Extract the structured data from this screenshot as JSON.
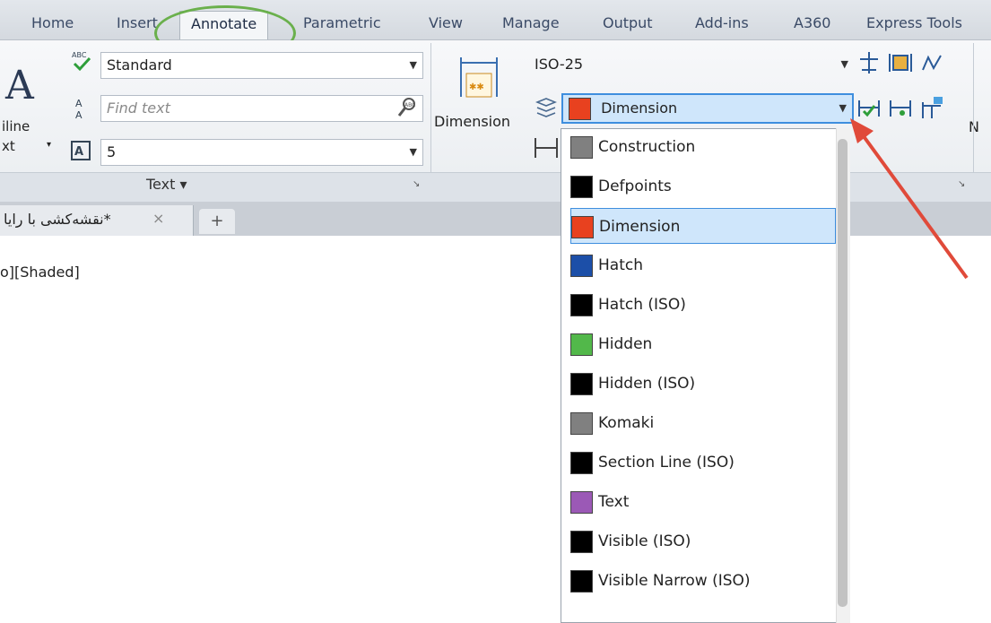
{
  "ribbon_tabs": [
    "Home",
    "Insert",
    "Annotate",
    "Parametric",
    "View",
    "Manage",
    "Output",
    "Add-ins",
    "A360",
    "Express Tools"
  ],
  "active_tab": "Annotate",
  "text_panel": {
    "big_label_line1": "iline",
    "big_label_line2": "xt",
    "style_value": "Standard",
    "find_placeholder": "Find text",
    "height_value": "5",
    "panel_title": "Text ▾"
  },
  "dim_panel": {
    "button_label": "Dimension",
    "dimstyle_value": "ISO-25",
    "layer_value": "Dimension",
    "layer_color": "#e8411f"
  },
  "right_edge_label": "N",
  "doc_tab": {
    "title": "*نقشه‌کشی با رایا",
    "close": "×",
    "new_tab": "+"
  },
  "viewport_label": "o][Shaded]",
  "layer_dropdown": {
    "items": [
      {
        "name": "Construction",
        "color": "#808080"
      },
      {
        "name": "Defpoints",
        "color": "#000000"
      },
      {
        "name": "Dimension",
        "color": "#e8411f",
        "selected": true
      },
      {
        "name": "Hatch",
        "color": "#1c4fa8"
      },
      {
        "name": "Hatch (ISO)",
        "color": "#000000"
      },
      {
        "name": "Hidden",
        "color": "#52b84a"
      },
      {
        "name": "Hidden (ISO)",
        "color": "#000000"
      },
      {
        "name": "Komaki",
        "color": "#808080"
      },
      {
        "name": "Section Line (ISO)",
        "color": "#000000"
      },
      {
        "name": "Text",
        "color": "#9b59b6"
      },
      {
        "name": "Visible (ISO)",
        "color": "#000000"
      },
      {
        "name": "Visible Narrow (ISO)",
        "color": "#000000"
      }
    ]
  },
  "icons": {
    "spellcheck": "spellcheck-icon",
    "find": "find-replace-icon",
    "textheight": "text-height-icon",
    "dimension": "dimension-icon",
    "layers": "layers-icon",
    "linear": "linear-dim-icon"
  }
}
